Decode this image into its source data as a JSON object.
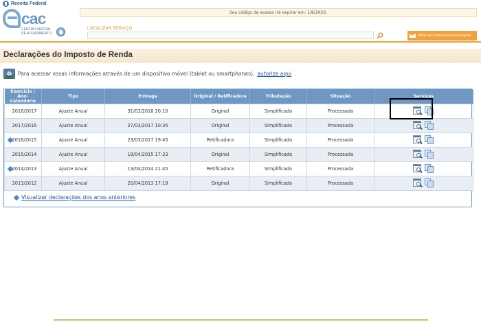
{
  "header": {
    "receita_label": "Receita Federal",
    "ecac_word": "cac",
    "ecac_subtitle": "Centro Virtual de Atendimento",
    "session_notice": "Seu código de acesso irá expirar em: 1/8/2020.",
    "search_label": "LOCALIZAR SERVIÇO",
    "search_value": "",
    "message_button": "Você tem uma nova mensagem"
  },
  "page": {
    "title": "Declarações do Imposto de Renda",
    "mobile_text": "Para acessar essas informações através de um dispositivo móvel (tablet ou smartphones),",
    "mobile_link": "autorize aqui",
    "mobile_suffix": "."
  },
  "table": {
    "headers": [
      "Exercício / Ano-Calendário",
      "Tipo",
      "Entrega",
      "Original / Retificadora",
      "Tributação",
      "Situação",
      "Serviços"
    ],
    "rows": [
      {
        "exercicio": "2018/2017",
        "tipo": "Ajuste Anual",
        "entrega": "31/03/2018 20:10",
        "original": "Original",
        "tributacao": "Simplificado",
        "situacao": "Processada",
        "has_marker": false
      },
      {
        "exercicio": "2017/2016",
        "tipo": "Ajuste Anual",
        "entrega": "27/03/2017 10:35",
        "original": "Original",
        "tributacao": "Simplificado",
        "situacao": "Processada",
        "has_marker": false
      },
      {
        "exercicio": "2016/2015",
        "tipo": "Ajuste Anual",
        "entrega": "23/03/2017 19:45",
        "original": "Retificadora",
        "tributacao": "Simplificado",
        "situacao": "Processada",
        "has_marker": true
      },
      {
        "exercicio": "2015/2014",
        "tipo": "Ajuste Anual",
        "entrega": "18/04/2015 17:33",
        "original": "Original",
        "tributacao": "Simplificado",
        "situacao": "Processada",
        "has_marker": false
      },
      {
        "exercicio": "2014/2013",
        "tipo": "Ajuste Anual",
        "entrega": "13/04/2014 21:45",
        "original": "Retificadora",
        "tributacao": "Simplificado",
        "situacao": "Processada",
        "has_marker": true
      },
      {
        "exercicio": "2013/2012",
        "tipo": "Ajuste Anual",
        "entrega": "20/04/2013 17:19",
        "original": "Original",
        "tributacao": "Simplificado",
        "situacao": "Processada",
        "has_marker": false
      }
    ],
    "service_icons": [
      "view-declaration-icon",
      "copy-declaration-icon"
    ]
  },
  "previous_link": "Visualizar declarações dos anos anteriores",
  "colors": {
    "accent_orange": "#f2a23a",
    "header_blue": "#6f97c4",
    "link_blue": "#1a4f9c",
    "row_alt": "#e9eef5"
  }
}
